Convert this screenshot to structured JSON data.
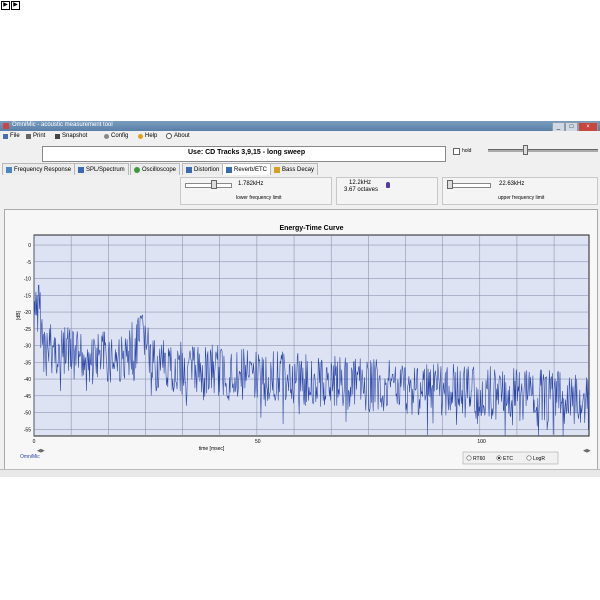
{
  "toolbar_buttons": {
    "a": "▶",
    "b": "▶"
  },
  "window": {
    "title": "OmniMic - acoustic measurement tool",
    "controls": {
      "minimize": "_",
      "maximize": "□",
      "close": "×"
    }
  },
  "menu": [
    {
      "label": "File",
      "icon": "file-icon"
    },
    {
      "label": "Print",
      "icon": "print-icon"
    },
    {
      "label": "Snapshot",
      "icon": "camera-icon"
    },
    {
      "label": "Config",
      "icon": "gear-icon"
    },
    {
      "label": "Help",
      "icon": "help-icon"
    },
    {
      "label": "About",
      "icon": "info-icon"
    }
  ],
  "info": {
    "text": "Use: CD Tracks 3,9,15 - long sweep"
  },
  "hold": {
    "label": "hold"
  },
  "tabs": [
    {
      "label": "Frequency Response",
      "icon": "frequency-icon"
    },
    {
      "label": "SPL/Spectrum",
      "icon": "spectrum-icon"
    },
    {
      "label": "Oscilloscope",
      "icon": "oscilloscope-icon"
    },
    {
      "label": "Distortion",
      "icon": "distortion-icon"
    },
    {
      "label": "Reverb/ETC",
      "icon": "reverb-icon"
    },
    {
      "label": "Bass Decay",
      "icon": "bass-decay-icon"
    }
  ],
  "active_tab": 4,
  "freq_controls": {
    "lower_value": "1.782kHz",
    "lower_label": "lower frequency limit",
    "center_value": "12.2kHz",
    "center_octaves": "3.67 octaves",
    "upper_value": "22.63kHz",
    "upper_label": "upper frequency limit"
  },
  "brand": "OmniMic",
  "radio": {
    "options": [
      "RT60",
      "ETC",
      "LogR"
    ],
    "selected": 1
  },
  "chart_data": {
    "type": "line",
    "title": "Energy-Time Curve",
    "xlabel": "time [msec]",
    "ylabel": "[dB]",
    "xlim": [
      0,
      124
    ],
    "ylim": [
      -57,
      3
    ],
    "xticks": [
      0,
      50,
      100
    ],
    "yticks": [
      0,
      -5,
      -10,
      -15,
      -20,
      -25,
      -30,
      -35,
      -40,
      -45,
      -50,
      -55
    ],
    "grid": true,
    "series": [
      {
        "color": "#2c46a8",
        "envelope": [
          {
            "x": 0,
            "y": -16
          },
          {
            "x": 1,
            "y": -8
          },
          {
            "x": 2,
            "y": -22
          },
          {
            "x": 6,
            "y": -24
          },
          {
            "x": 20,
            "y": -26
          },
          {
            "x": 25,
            "y": -18
          },
          {
            "x": 26,
            "y": -28
          },
          {
            "x": 50,
            "y": -31
          },
          {
            "x": 75,
            "y": -34
          },
          {
            "x": 100,
            "y": -36
          },
          {
            "x": 124,
            "y": -38
          }
        ]
      }
    ]
  },
  "colors": {
    "plot_bg": "#dde3f3",
    "grid": "#7d86a6",
    "trace": "#2c46a8"
  }
}
